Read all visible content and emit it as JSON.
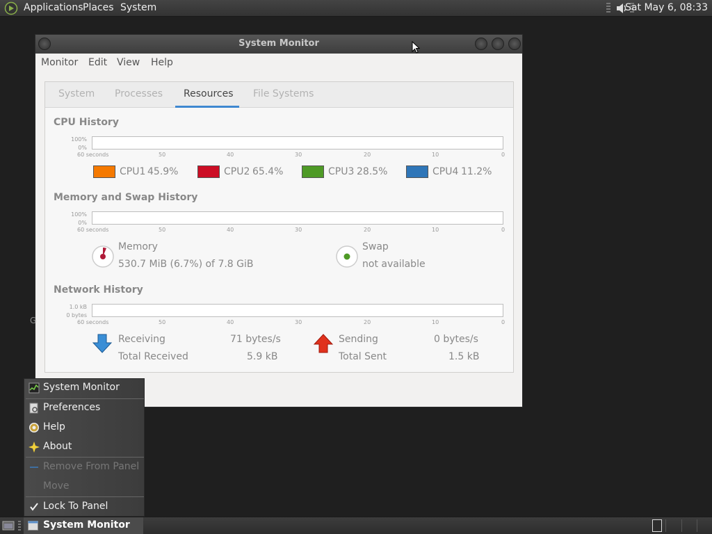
{
  "top_panel": {
    "menus": [
      "Applications",
      "Places",
      "System"
    ],
    "clock": "Sat May  6, 08:33"
  },
  "window": {
    "title": "System Monitor",
    "menubar": [
      "Monitor",
      "Edit",
      "View",
      "Help"
    ],
    "tabs": [
      "System",
      "Processes",
      "Resources",
      "File Systems"
    ],
    "active_tab": "Resources",
    "cpu": {
      "title": "CPU History",
      "y_labels": [
        "100%",
        "0%"
      ],
      "x_labels": [
        "60 seconds",
        "50",
        "40",
        "30",
        "20",
        "10",
        "0"
      ],
      "legend": [
        {
          "name": "CPU1",
          "value": "45.9%",
          "color": "#f57900"
        },
        {
          "name": "CPU2",
          "value": "65.4%",
          "color": "#cc0e25"
        },
        {
          "name": "CPU3",
          "value": "28.5%",
          "color": "#4e9a26"
        },
        {
          "name": "CPU4",
          "value": "11.2%",
          "color": "#2f76b8"
        }
      ]
    },
    "memory": {
      "title": "Memory and Swap History",
      "y_labels": [
        "100%",
        "0%"
      ],
      "x_labels": [
        "60 seconds",
        "50",
        "40",
        "30",
        "20",
        "10",
        "0"
      ],
      "memory_label": "Memory",
      "memory_value": "530.7 MiB (6.7%) of 7.8 GiB",
      "swap_label": "Swap",
      "swap_value": "not available"
    },
    "network": {
      "title": "Network History",
      "y_labels": [
        "1.0 kB",
        "0 bytes"
      ],
      "x_labels": [
        "60 seconds",
        "50",
        "40",
        "30",
        "20",
        "10",
        "0"
      ],
      "receiving_label": "Receiving",
      "receiving_value": "71 bytes/s",
      "total_received_label": "Total Received",
      "total_received_value": "5.9 kB",
      "sending_label": "Sending",
      "sending_value": "0 bytes/s",
      "total_sent_label": "Total Sent",
      "total_sent_value": "1.5 kB"
    }
  },
  "context_menu": {
    "items": [
      {
        "label": "System Monitor",
        "icon": "system-monitor-icon",
        "enabled": true
      },
      {
        "label": "Preferences",
        "icon": "preferences-icon",
        "enabled": true
      },
      {
        "label": "Help",
        "icon": "help-icon",
        "enabled": true
      },
      {
        "label": "About",
        "icon": "about-icon",
        "enabled": true
      },
      {
        "label": "Remove From Panel",
        "icon": "remove-icon",
        "enabled": false
      },
      {
        "label": "Move",
        "icon": "",
        "enabled": false
      },
      {
        "label": "Lock To Panel",
        "icon": "checkmark-icon",
        "enabled": true
      }
    ]
  },
  "taskbar": {
    "task_label": "System Monitor"
  },
  "desktop": {
    "stray_text": "G"
  }
}
